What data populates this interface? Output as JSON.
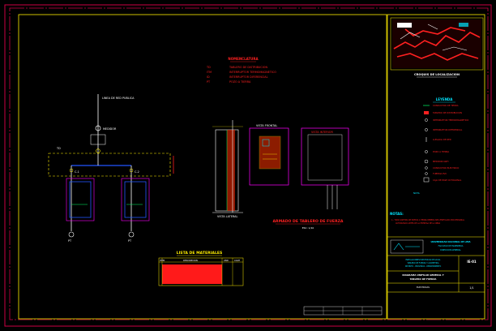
{
  "nomenclature": {
    "title": "NOMENCLATURA",
    "items": [
      {
        "code": "TD",
        "text": "TABLERO DE DISTRIBUCION"
      },
      {
        "code": "ITM",
        "text": "INTERRUPTOR TERMOMAGNETICO"
      },
      {
        "code": "ID",
        "text": "INTERRUPTOR DIFERENCIAL"
      },
      {
        "code": "PT",
        "text": "POZO A TIERRA"
      }
    ]
  },
  "single_line": {
    "source_label": "LINEA DE RED PUBLICA",
    "meter_label": "MEDIDOR",
    "board_label": "TD",
    "circuit_labels": [
      "C-1",
      "C-2"
    ],
    "ground_labels": [
      "PT",
      "PT"
    ]
  },
  "board_layout": {
    "title": "ARMADO DE TABLERO DE FUERZA",
    "side_label": "VISTA LATERAL",
    "front_label": "VISTA FRONTAL",
    "interior_label": "VISTA INTERIOR",
    "scale_label": "ESC: 1/10"
  },
  "materials": {
    "title": "LISTA DE MATERIALES",
    "header": [
      "ITEM",
      "DESCRIPCION",
      "UND",
      "CANT"
    ]
  },
  "location": {
    "title": "CROQUIS DE LOCALIZACION"
  },
  "legend": {
    "title": "LEYENDA",
    "items": [
      "CONDUCTOR DE TIERRA",
      "TABLERO DE DISTRIBUCION",
      "INTERRUPTOR TERMOMAGNETICO",
      "INTERRUPTOR DIFERENCIAL",
      "LLEGADA DE RED",
      "POZO A TIERRA",
      "MEDIDOR KWH",
      "CONDUCTOR ELECTRICO",
      "TUBERIA PVC",
      "CAJA DE PASE OCTOGONAL"
    ],
    "footer": "NOTA"
  },
  "notes": {
    "title": "NOTAS:",
    "lines": [
      "1.- TODO SISTEMA DE PUESTA A TIERRA DEBERA SER VERIFICADO POR PERSONAL",
      "AUTORIZADO ANTES DE LA ENTREGA DE LA OBRA"
    ]
  },
  "title_block": {
    "institution_lines": [
      "UNIVERSIDAD NACIONAL DE LIMA",
      "FACULTAD DE INGENIERIA",
      "DIRECCION GENERAL"
    ],
    "project_lines": [
      "INSTALACIONES ELECTRICAS DE LOCAL",
      "TABLERO DE FUERZA Y ACOMETIDA",
      "DISTRITO - PROVINCIA - DEPARTAMENTO"
    ],
    "sheet_code": "IE-01",
    "drawing_title_lines": [
      "DIAGRAMA UNIFILAR GENERAL Y",
      "TABLERO DE FUERZA"
    ],
    "specialty": "ELECTRICAS",
    "sheet_number": "1/1"
  },
  "colors": {
    "background": "#000000",
    "border": "#cc0044",
    "frame": "#ffee00",
    "wire": "#ffffff",
    "accent_cyan": "#00e5ff",
    "accent_red": "#ff2020",
    "accent_magenta": "#ff00ff",
    "accent_green": "#00ff66",
    "board_fill": "#ff3300"
  }
}
